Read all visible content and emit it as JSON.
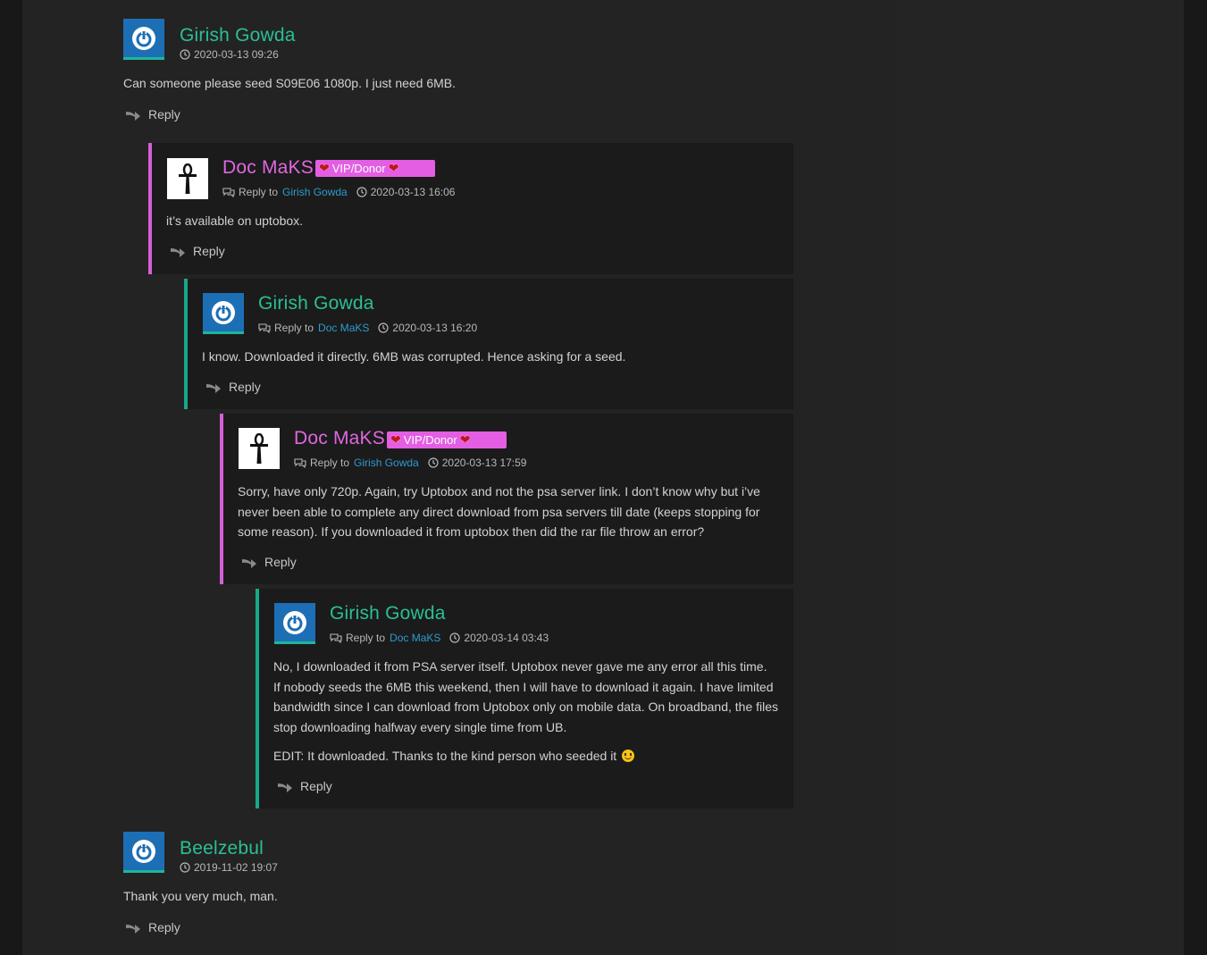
{
  "reply_label": "Reply",
  "reply_to_label": "Reply to",
  "badge_label": "VIP/Donor",
  "comments": [
    {
      "author": "Girish Gowda",
      "time": "2020-03-13 09:26",
      "body": [
        "Can someone please seed S09E06 1080p. I just need 6MB."
      ]
    },
    {
      "author": "Doc MaKS",
      "reply_to": "Girish Gowda",
      "time": "2020-03-13 16:06",
      "body": [
        "it’s available on uptobox."
      ]
    },
    {
      "author": "Girish Gowda",
      "reply_to": "Doc MaKS",
      "time": "2020-03-13 16:20",
      "body": [
        "I know. Downloaded it directly. 6MB was corrupted. Hence asking for a seed."
      ]
    },
    {
      "author": "Doc MaKS",
      "reply_to": "Girish Gowda",
      "time": "2020-03-13 17:59",
      "body": [
        "Sorry, have only 720p. Again, try Uptobox and not the psa server link. I don’t know why but i’ve never been able to complete any direct download from psa servers till date (keeps stopping for some reason). If you downloaded it from uptobox then did the rar file throw an error?"
      ]
    },
    {
      "author": "Girish Gowda",
      "reply_to": "Doc MaKS",
      "time": "2020-03-14 03:43",
      "body": [
        "No, I downloaded it from PSA server itself. Uptobox never gave me any error all this time.",
        "If nobody seeds the 6MB this weekend, then I will have to download it again. I have limited bandwidth since I can download from Uptobox only on mobile data. On broadband, the files stop downloading halfway every single time from UB.",
        "EDIT: It downloaded. Thanks to the kind person who seeded it"
      ]
    },
    {
      "author": "Beelzebul",
      "time": "2019-11-02 19:07",
      "body": [
        "Thank you very much, man."
      ]
    }
  ],
  "colors": {
    "teal_name": "#2bbf95",
    "pink_name": "#e067e0",
    "link": "#2e9ad0",
    "badge": "#e35ee3"
  }
}
